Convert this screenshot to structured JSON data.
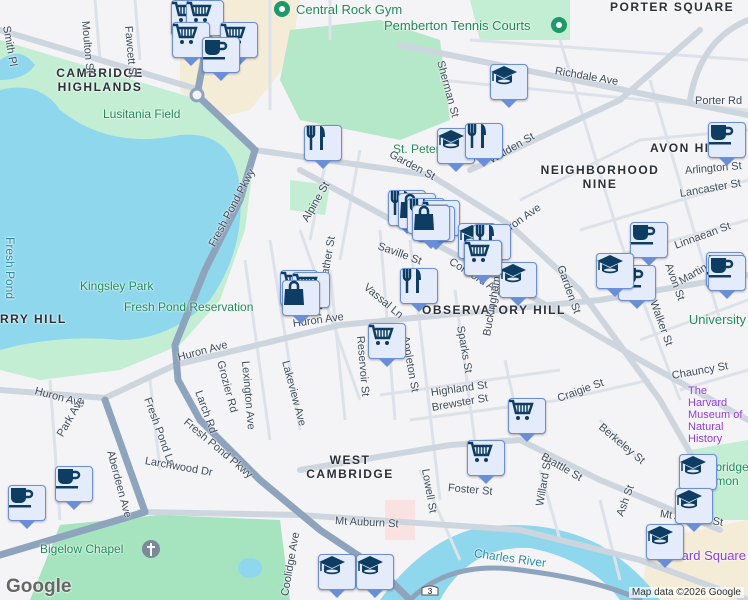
{
  "map": {
    "attribution": "Map data ©2026 Google",
    "logo": "Google",
    "colors": {
      "water": "#8fd7ec",
      "park": "#c3eed3",
      "road": "#d6dde6",
      "highway": "#8ea4bd",
      "marker_fill": "#e4ebfb",
      "marker_border": "#6a8fd6",
      "icon": "#0d3d62"
    },
    "neighborhoods": [
      "CAMBRIDGE HIGHLANDS",
      "PORTER SQUARE",
      "AVON HILL",
      "NEIGHBORHOOD NINE",
      "OBSERVATORY HILL",
      "WEST CAMBRIDGE",
      "RRY HILL"
    ],
    "places": [
      "Central Rock Gym",
      "Pemberton Tennis Courts",
      "Lusitania Field",
      "Fresh Pond",
      "Kingsley Park",
      "Fresh Pond Reservation",
      "St. Peter",
      "Bigelow Chapel",
      "Charles River",
      "The Harvard Museum of Natural History",
      "Harvard Square",
      "Cambridge Common",
      "University"
    ],
    "streets": [
      "Huron Ave",
      "Huron Ave",
      "Huron Ave",
      "Huron Ave",
      "Fresh Pond Pkwy",
      "Fresh Pond Pkwy",
      "Mt Auburn St",
      "Mt Auburn St",
      "Brattle St",
      "Garden St",
      "Garden St",
      "Concord Ave",
      "Walden St",
      "Richdale Ave",
      "Sherman St",
      "Alpine St",
      "Saville St",
      "Vassal Ln",
      "Reservoir St",
      "Appleton St",
      "Sparks St",
      "Buckingham St",
      "Highland St",
      "Brewster St",
      "Craigie St",
      "Berkeley St",
      "Lowell St",
      "Foster St",
      "Willard St",
      "Ash St",
      "Chauncy St",
      "Walker St",
      "Avon St",
      "Martin St",
      "Linnaean St",
      "Lancaster St",
      "Arlington St",
      "Fayerweather St",
      "Lakeview Ave",
      "Lexington Ave",
      "Grozier Rd",
      "Larch Rd",
      "Fresh Pond Ln",
      "Larchwood Dr",
      "Aberdeen Ave",
      "Park Ave",
      "Coolidge Ave",
      "Moulton St",
      "Fawcett St",
      "Smith Pl",
      "Porter Rd"
    ],
    "markers": [
      "shopping-cart",
      "shopping-cart",
      "shopping-cart",
      "shopping-cart",
      "coffee",
      "restaurant",
      "school",
      "restaurant",
      "restaurant",
      "shopping-bag",
      "restaurant",
      "shopping-cart",
      "school",
      "shopping-bag",
      "restaurant",
      "shopping-cart",
      "shopping-cart",
      "shopping-cart",
      "school",
      "coffee",
      "coffee",
      "school",
      "coffee",
      "coffee",
      "coffee",
      "school",
      "school",
      "school",
      "coffee"
    ],
    "route_shield": "3"
  }
}
